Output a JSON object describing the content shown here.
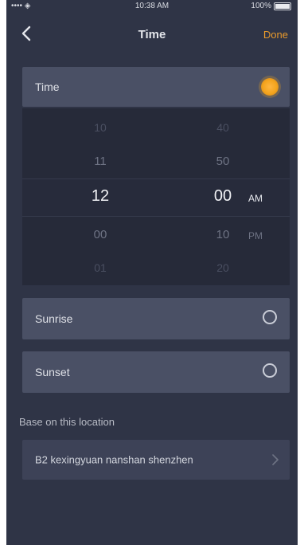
{
  "status_bar": {
    "carrier": "•••• ◈",
    "time": "10:38 AM",
    "battery": "100%"
  },
  "nav": {
    "title": "Time",
    "done_label": "Done",
    "back_icon": "chevron-left-icon"
  },
  "time_row": {
    "label": "Time",
    "icon": "sun-icon",
    "icon_color": "#f4a41d"
  },
  "picker": {
    "hours": [
      "10",
      "11",
      "12",
      "00",
      "01"
    ],
    "minutes": [
      "40",
      "50",
      "00",
      "10",
      "20"
    ],
    "selected_hour": "12",
    "selected_minute": "00",
    "period_selected": "AM",
    "period_other": "PM"
  },
  "sunrise": {
    "label": "Sunrise",
    "selected": false
  },
  "sunset": {
    "label": "Sunset",
    "selected": false
  },
  "location_section": {
    "title": "Base on this location",
    "address": "B2 kexingyuan nanshan shenzhen"
  },
  "colors": {
    "background": "#2f3446",
    "row": "#4a5065",
    "accent": "#e89a2c"
  }
}
